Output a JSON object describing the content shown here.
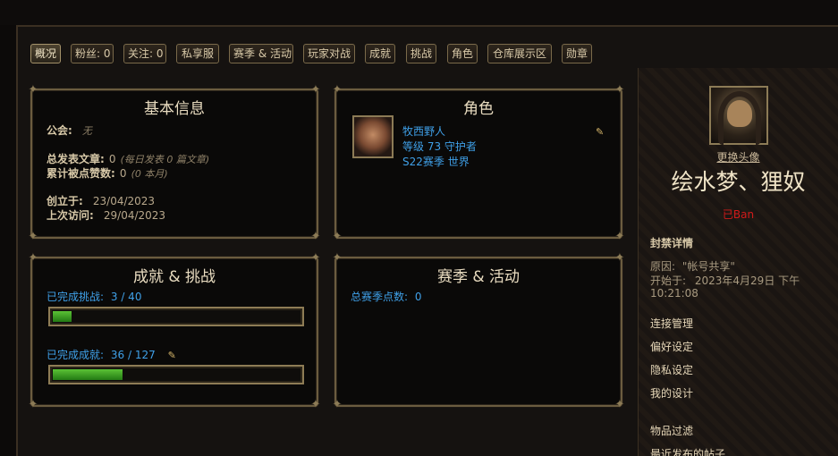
{
  "tabs": [
    {
      "label": "概况",
      "active": true
    },
    {
      "label": "粉丝: 0"
    },
    {
      "label": "关注: 0"
    },
    {
      "label": "私享服"
    },
    {
      "label": "赛季 & 活动"
    },
    {
      "label": "玩家对战"
    },
    {
      "label": "成就"
    },
    {
      "label": "挑战"
    },
    {
      "label": "角色"
    },
    {
      "label": "仓库展示区"
    },
    {
      "label": "勋章"
    }
  ],
  "basic_info": {
    "title": "基本信息",
    "guild_label": "公会:",
    "guild_value": "无",
    "posts_label": "总发表文章:",
    "posts_value": "0",
    "posts_note": "(每日发表 0 篇文章)",
    "likes_label": "累计被点赞数:",
    "likes_value": "0",
    "likes_note": "(0 本月)",
    "created_label": "创立于:",
    "created_value": "23/04/2023",
    "visited_label": "上次访问:",
    "visited_value": "29/04/2023"
  },
  "character": {
    "title": "角色",
    "name": "牧西野人",
    "level": "等级 73 守护者",
    "season": "S22赛季 世界"
  },
  "achievements": {
    "title": "成就 & 挑战",
    "challenges_label": "已完成挑战:",
    "challenges_value": "3 / 40",
    "challenges_fraction": 0.075,
    "achievements_label": "已完成成就:",
    "achievements_value": "36 / 127",
    "achievements_fraction": 0.283
  },
  "season": {
    "title": "赛季 & 活动",
    "points_label": "总赛季点数:",
    "points_value": "0"
  },
  "sidebar": {
    "change_avatar": "更换头像",
    "username": "绘水梦、狸奴",
    "status": "已Ban",
    "ban_details_title": "封禁详情",
    "reason_label": "原因:",
    "reason_value": "\"帐号共享\"",
    "start_label": "开始于:",
    "start_value": "2023年4月29日 下午",
    "start_time": "10:21:08",
    "links": [
      "连接管理",
      "偏好设定",
      "隐私设定",
      "我的设计",
      "物品过滤",
      "最近发布的帖子"
    ]
  },
  "colors": {
    "accent_blue": "#3fa0e8",
    "banned_red": "#d11a1a",
    "progress_green": "#4fb82c",
    "gold_border": "#8c7b56"
  }
}
